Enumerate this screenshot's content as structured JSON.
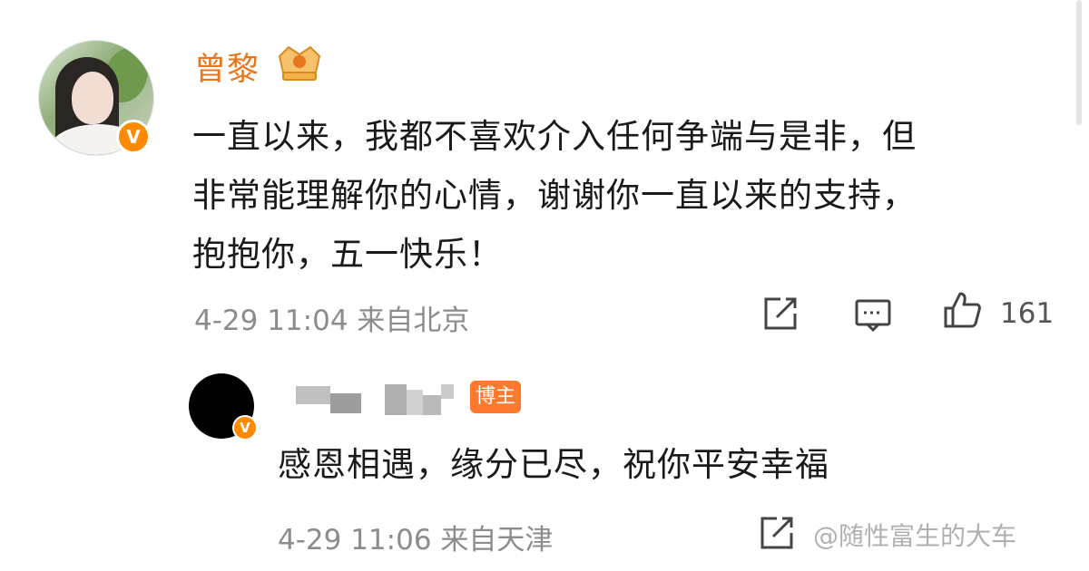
{
  "main_comment": {
    "username": "曾黎",
    "content_lines": [
      "一直以来，我都不喜欢介入任何争端与是非，但",
      "非常能理解你的心情，谢谢你一直以来的支持，",
      "抱抱你，五一快乐！"
    ],
    "verified_badge": "V",
    "time": "4-29 11:04",
    "location": "来自北京",
    "like_count": "161",
    "icons": [
      "share-icon",
      "comment-icon",
      "like-icon",
      "crown-icon"
    ]
  },
  "reply": {
    "badge": "博主",
    "verified_badge": "V",
    "content": "感恩相遇，缘分已尽，祝你平安幸福",
    "time": "4-29 11:06",
    "location": "来自天津",
    "watermark": "@随性富生的大车"
  },
  "colors": {
    "username": "#e8761e",
    "verified": "#ff8a00",
    "bozhu_badge": "#ff7a2e",
    "meta_text": "#8c8c8c",
    "body_text": "#1a1a1a"
  }
}
